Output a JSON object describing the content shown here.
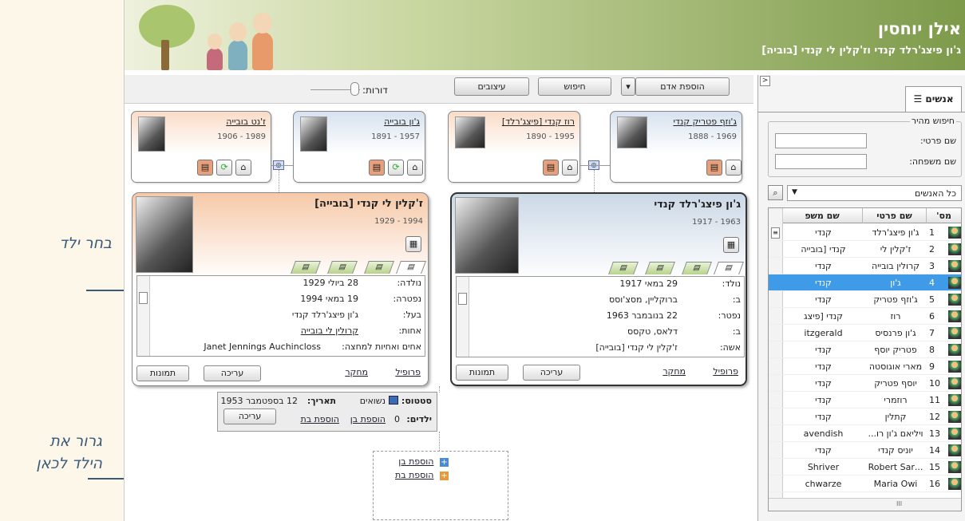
{
  "annotations": {
    "choose_child": "בחר ילד",
    "drag_here_1": "גרור את",
    "drag_here_2": "הילד לכאן"
  },
  "header": {
    "title": "אילן יוחסין",
    "subtitle": "ג'ון פיצג'רלד קנדי וז'קלין לי קנדי [בוביה]"
  },
  "toolbar": {
    "add_person": "הוספת אדם",
    "search": "חיפוש",
    "designs": "עיצובים",
    "generations": "דורות:"
  },
  "parents": [
    {
      "name": "ג'וזף פטריק קנדי",
      "dates": "1888 - 1969"
    },
    {
      "name": "רוז קנדי [פיצג'רלד]",
      "dates": "1890 - 1995"
    },
    {
      "name": "ג'ון בובייה",
      "dates": "1891 - 1957"
    },
    {
      "name": "ז'נט בובייה",
      "dates": "1906 - 1989"
    }
  ],
  "husband": {
    "name": "ג'ון פיצג'רלד קנדי",
    "dates": "1917 - 1963",
    "rows": [
      {
        "label": "נולד:",
        "value": "29 במאי 1917"
      },
      {
        "label": "ב:",
        "value": "ברוקליין, מסצ'וסס"
      },
      {
        "label": "נפטר:",
        "value": "22 בנובמבר 1963"
      },
      {
        "label": "ב:",
        "value": "דלאס, טקסס"
      },
      {
        "label": "אשה:",
        "value": "ז'קלין לי קנדי [בובייה]"
      }
    ],
    "profile": "פרופיל",
    "research": "מחקר",
    "edit": "עריכה",
    "photos": "תמונות"
  },
  "wife": {
    "name": "ז'קלין לי קנדי [בובייה]",
    "dates": "1929 - 1994",
    "rows": [
      {
        "label": "נולדה:",
        "value": "28 ביולי 1929"
      },
      {
        "label": "נפטרה:",
        "value": "19 במאי 1994"
      },
      {
        "label": "בעל:",
        "value": "ג'ון פיצג'רלד קנדי"
      },
      {
        "label": "אחות:",
        "value": "קרולין לי בובייה"
      },
      {
        "label": "אחים ואחיות למחצה:",
        "value": "Janet Jennings Auchincloss"
      }
    ],
    "profile": "פרופיל",
    "research": "מחקר",
    "edit": "עריכה",
    "photos": "תמונות"
  },
  "family": {
    "status_label": "סטטוס:",
    "status_value": "נשואים",
    "date_label": "תאריך:",
    "date_value": "12 בספטמבר 1953",
    "children_label": "ילדים:",
    "children_count": "0",
    "add_son": "הוספת בן",
    "add_daughter": "הוספת בת",
    "edit": "עריכה"
  },
  "child_box": {
    "add_son": "הוספת בן",
    "add_daughter": "הוספת בת"
  },
  "side_panel": {
    "tab_people": "אנשים",
    "quick_search": "חיפוש מהיר",
    "first_name_label": "שם פרטי:",
    "last_name_label": "שם משפחה:",
    "filter": "כל האנשים",
    "columns": [
      "מס'",
      "שם פרטי",
      "שם משפ"
    ],
    "rows": [
      {
        "num": "1",
        "first": "ג'ון פיצג'רלד",
        "last": "קנדי"
      },
      {
        "num": "2",
        "first": "ז'קלין לי",
        "last": "קנדי [בובייה"
      },
      {
        "num": "3",
        "first": "קרולין בובייה",
        "last": "קנדי"
      },
      {
        "num": "4",
        "first": "ג'ון",
        "last": "קנדי"
      },
      {
        "num": "5",
        "first": "ג'וזף פטריק",
        "last": "קנדי"
      },
      {
        "num": "6",
        "first": "רוז",
        "last": "קנדי [פיצג"
      },
      {
        "num": "7",
        "first": "ג'ון פרנסיס",
        "last": "itzgerald"
      },
      {
        "num": "8",
        "first": "פטריק יוסף",
        "last": "קנדי"
      },
      {
        "num": "9",
        "first": "מארי אוגוסטה",
        "last": "קנדי"
      },
      {
        "num": "10",
        "first": "יוסף פטריק",
        "last": "קנדי"
      },
      {
        "num": "11",
        "first": "רוזמרי",
        "last": "קנדי"
      },
      {
        "num": "12",
        "first": "קתלין",
        "last": "קנדי"
      },
      {
        "num": "13",
        "first": "ויליאם ג'ון רו...",
        "last": "avendish"
      },
      {
        "num": "14",
        "first": "יוניס קנדי",
        "last": "קנדי"
      },
      {
        "num": "15",
        "first": "...Robert Sar",
        "last": "Shriver"
      },
      {
        "num": "16",
        "first": "Maria Owi",
        "last": "chwarze"
      }
    ],
    "selected_row": 3,
    "scroll_glyph": "III"
  },
  "colors": {
    "selection": "#3f9be8",
    "header_green": "#7d9a4a"
  }
}
